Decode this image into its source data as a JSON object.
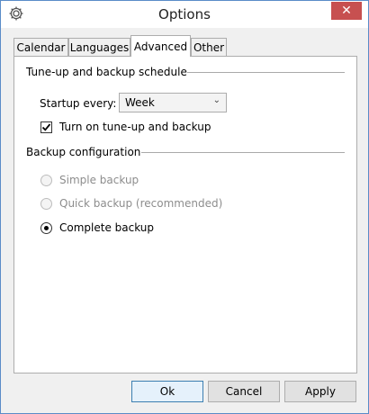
{
  "window": {
    "title": "Options",
    "close_glyph": "✕",
    "icon": "gear-icon"
  },
  "tabs": [
    {
      "label": "Calendar",
      "active": false
    },
    {
      "label": "Languages",
      "active": false
    },
    {
      "label": "Advanced",
      "active": true
    },
    {
      "label": "Other",
      "active": false
    }
  ],
  "schedule": {
    "heading": "Tune-up and backup schedule",
    "startup_label": "Startup every:",
    "startup_value": "Week",
    "checkbox_label": "Turn on tune-up and backup",
    "checkbox_checked": true
  },
  "backup": {
    "heading": "Backup configuration",
    "options": [
      {
        "label": "Simple backup",
        "enabled": false,
        "selected": false
      },
      {
        "label": "Quick backup (recommended)",
        "enabled": false,
        "selected": false
      },
      {
        "label": "Complete backup",
        "enabled": true,
        "selected": true
      }
    ]
  },
  "buttons": {
    "ok": "Ok",
    "cancel": "Cancel",
    "apply": "Apply"
  },
  "colors": {
    "accent": "#3c7fb1",
    "close": "#c75050",
    "border": "#5a8cc8"
  }
}
